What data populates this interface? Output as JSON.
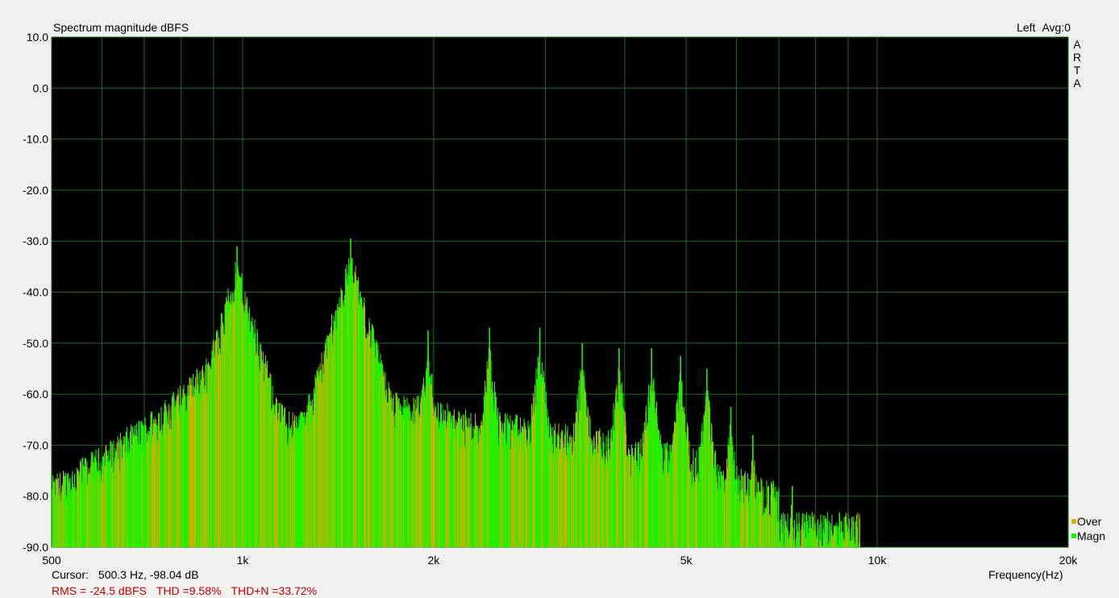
{
  "title": "Spectrum magnitude dBFS",
  "channel": "Left",
  "averages": "Avg:0",
  "brand_letters": [
    "A",
    "R",
    "T",
    "A"
  ],
  "cursor": {
    "label": "Cursor:",
    "value": "500.3 Hz, -98.04 dB"
  },
  "stats": {
    "rms": "RMS =  -24.5 dBFS",
    "thd": "THD =9.58%",
    "thdn": "THD+N =33.72%"
  },
  "legend": [
    {
      "label": "Over",
      "color": "#d4b000"
    },
    {
      "label": "Magn",
      "color": "#00ff00"
    }
  ],
  "colors": {
    "plot_bg": "#000000",
    "grid": "#1f6b1f",
    "magn": "#22ee00",
    "over": "#c8b400",
    "stats": "#c00000"
  },
  "chart_data": {
    "type": "line",
    "title": "Spectrum magnitude dBFS",
    "xlabel": "Frequency(Hz)",
    "ylabel": "",
    "x_scale": "log",
    "xlim": [
      500,
      20000
    ],
    "ylim": [
      -90,
      10
    ],
    "grid": true,
    "legend_position": "bottom-right",
    "y_ticks": [
      "10.0",
      "0.0",
      "-10.0",
      "-20.0",
      "-30.0",
      "-40.0",
      "-50.0",
      "-60.0",
      "-70.0",
      "-80.0",
      "-90.0"
    ],
    "y_tick_values": [
      10,
      0,
      -10,
      -20,
      -30,
      -40,
      -50,
      -60,
      -70,
      -80,
      -90
    ],
    "x_ticks": [
      {
        "value": 500,
        "label": "500"
      },
      {
        "value": 1000,
        "label": "1k"
      },
      {
        "value": 2000,
        "label": "2k"
      },
      {
        "value": 5000,
        "label": "5k"
      },
      {
        "value": 10000,
        "label": "10k"
      },
      {
        "value": 20000,
        "label": "20k"
      }
    ],
    "x_minor_grid": [
      600,
      700,
      800,
      900,
      3000,
      4000,
      6000,
      7000,
      8000,
      9000
    ],
    "series": [
      {
        "name": "Magn",
        "floor": [
          [
            500,
            -88
          ],
          [
            600,
            -82
          ],
          [
            700,
            -76
          ],
          [
            800,
            -70
          ],
          [
            900,
            -63
          ],
          [
            950,
            -58
          ],
          [
            1100,
            -72
          ],
          [
            1200,
            -75
          ],
          [
            1300,
            -74
          ],
          [
            1400,
            -70
          ],
          [
            1600,
            -70
          ],
          [
            1800,
            -72
          ],
          [
            2000,
            -72
          ],
          [
            2200,
            -75
          ],
          [
            2500,
            -75
          ],
          [
            3000,
            -77
          ],
          [
            3500,
            -78
          ],
          [
            4000,
            -80
          ],
          [
            4500,
            -81
          ],
          [
            5000,
            -82
          ],
          [
            5500,
            -84
          ],
          [
            6000,
            -86
          ],
          [
            6500,
            -88
          ],
          [
            7000,
            -90
          ]
        ],
        "peaks": [
          {
            "f": 980,
            "db": -31
          },
          {
            "f": 1480,
            "db": -29.5
          },
          {
            "f": 1960,
            "db": -47.5
          },
          {
            "f": 2450,
            "db": -47
          },
          {
            "f": 2940,
            "db": -47
          },
          {
            "f": 3430,
            "db": -50
          },
          {
            "f": 3920,
            "db": -51
          },
          {
            "f": 4410,
            "db": -51
          },
          {
            "f": 4900,
            "db": -52.5
          },
          {
            "f": 5390,
            "db": -55
          },
          {
            "f": 5880,
            "db": -62.5
          },
          {
            "f": 6370,
            "db": -68
          },
          {
            "f": 6860,
            "db": -77
          },
          {
            "f": 7350,
            "db": -78
          },
          {
            "f": 7840,
            "db": -84
          },
          {
            "f": 8330,
            "db": -85
          },
          {
            "f": 8820,
            "db": -87
          },
          {
            "f": 9310,
            "db": -89
          }
        ]
      },
      {
        "name": "Over"
      }
    ]
  }
}
